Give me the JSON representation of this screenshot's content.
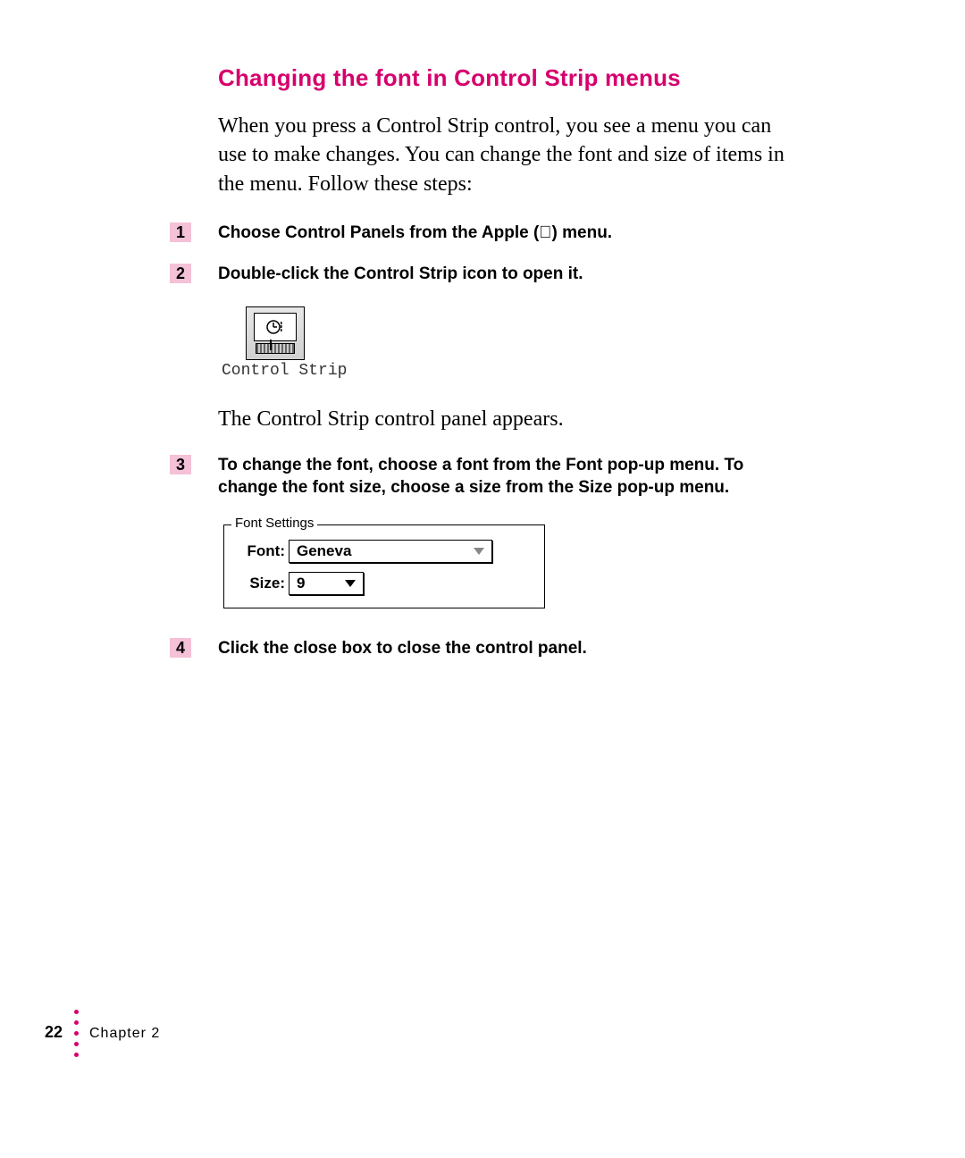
{
  "heading": "Changing the font in Control Strip menus",
  "intro": "When you press a Control Strip control, you see a menu you can use to make changes. You can change the font and size of items in the menu. Follow these steps:",
  "steps": {
    "s1": {
      "num": "1",
      "text_before": "Choose Control Panels from the Apple (",
      "text_after": ") menu."
    },
    "s2": {
      "num": "2",
      "text": "Double-click the Control Strip icon to open it."
    },
    "s3": {
      "num": "3",
      "text": "To change the font, choose a font from the Font pop-up menu. To change the font size, choose a size from the Size pop-up menu."
    },
    "s4": {
      "num": "4",
      "text": "Click the close box to close the control panel."
    }
  },
  "icon_caption": "Control Strip",
  "body_after_icon": "The Control Strip control panel appears.",
  "font_settings": {
    "legend": "Font Settings",
    "font_label": "Font:",
    "font_value": "Geneva",
    "size_label": "Size:",
    "size_value": "9"
  },
  "footer": {
    "page": "22",
    "chapter": "Chapter 2"
  }
}
